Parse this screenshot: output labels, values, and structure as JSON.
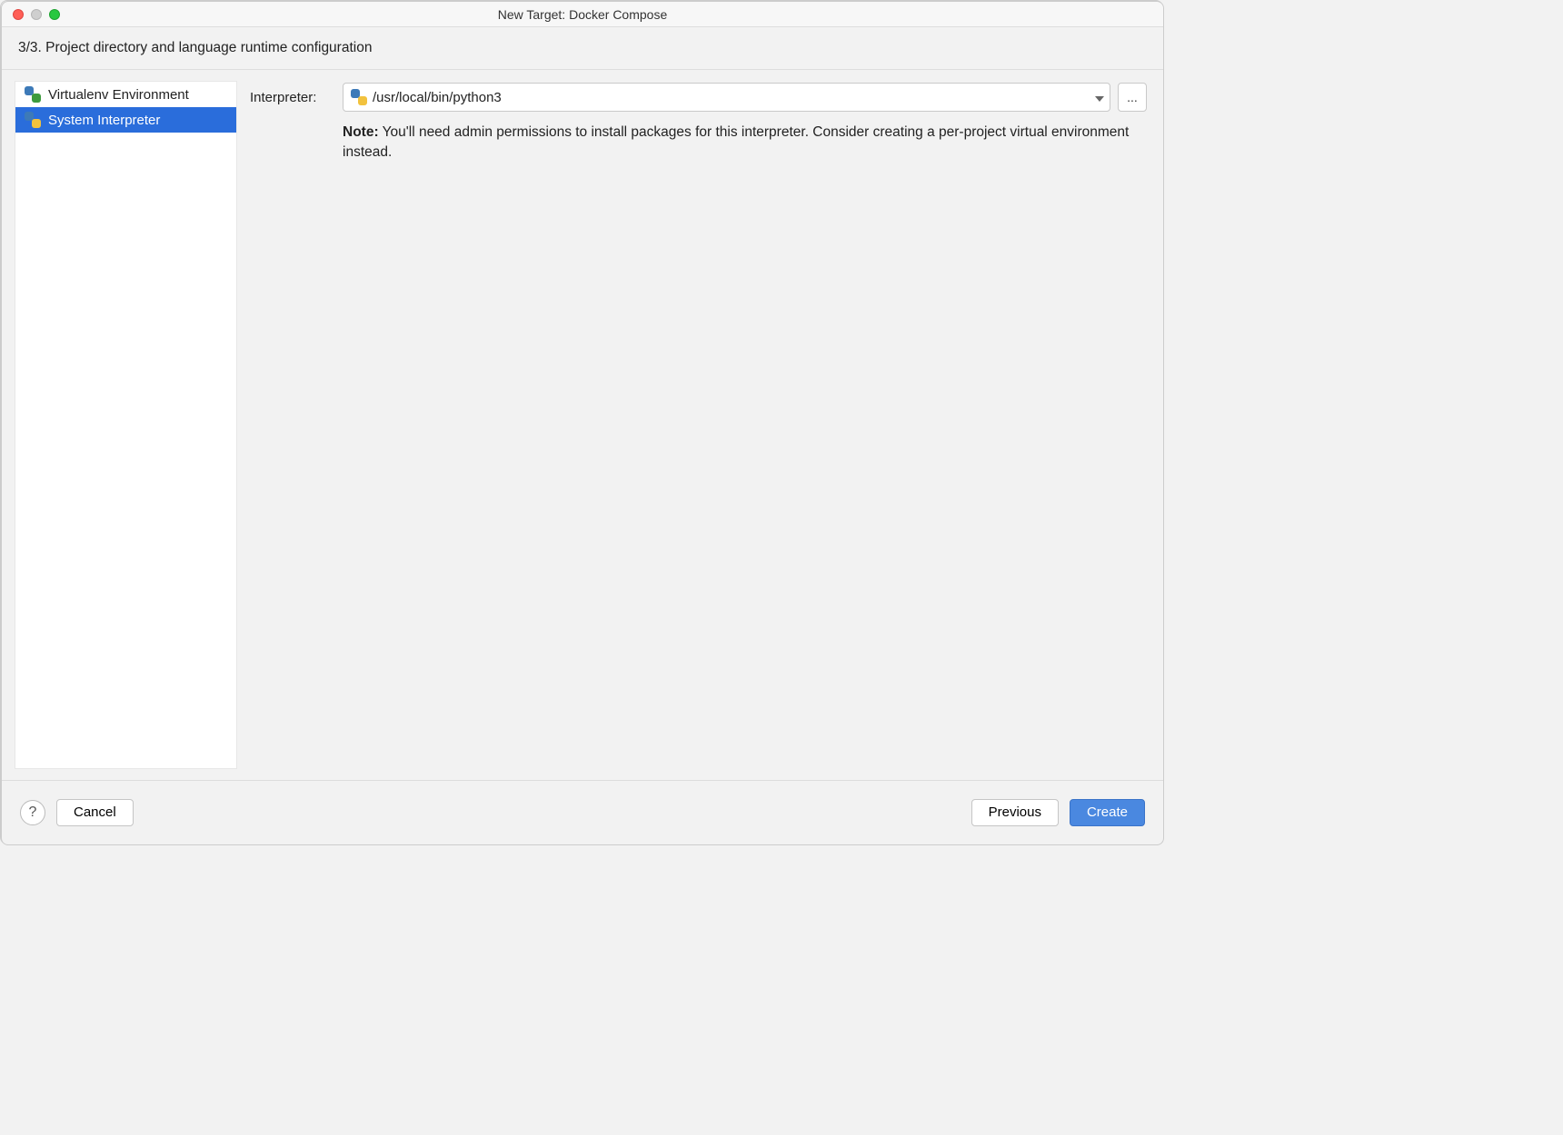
{
  "titlebar": {
    "title": "New Target: Docker Compose"
  },
  "step_header": "3/3. Project directory and language runtime configuration",
  "sidebar": {
    "items": [
      {
        "label": "Virtualenv Environment",
        "selected": false
      },
      {
        "label": "System Interpreter",
        "selected": true
      }
    ]
  },
  "form": {
    "interpreter_label": "Interpreter:",
    "interpreter_value": "/usr/local/bin/python3",
    "browse_label": "...",
    "note_bold": "Note:",
    "note_text": " You'll need admin permissions to install packages for this interpreter. Consider creating a per-project virtual environment instead."
  },
  "footer": {
    "help_label": "?",
    "cancel_label": "Cancel",
    "previous_label": "Previous",
    "create_label": "Create"
  }
}
